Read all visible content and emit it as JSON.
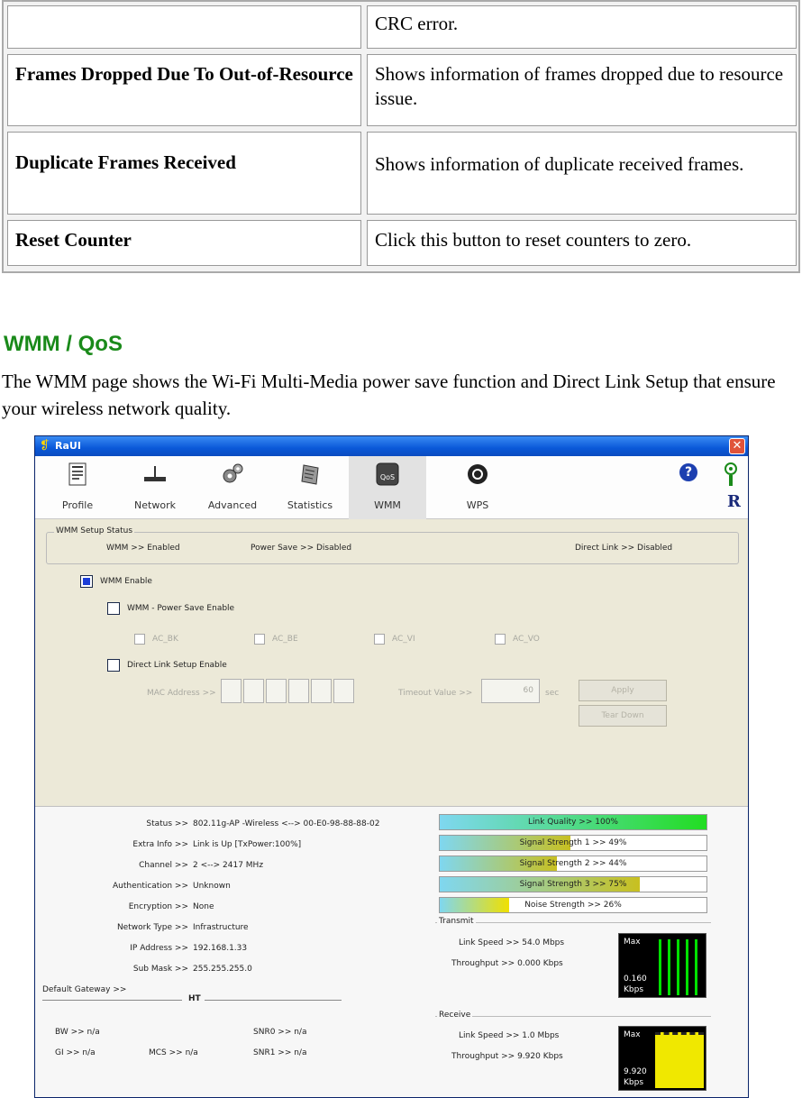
{
  "doc_table": {
    "rows": [
      {
        "key": "",
        "value": "CRC error."
      },
      {
        "key": "Frames Dropped Due To Out-of-Resource",
        "value": "Shows information of frames dropped due to resource issue."
      },
      {
        "key": "Duplicate Frames Received",
        "value": "Shows information of duplicate received frames."
      },
      {
        "key": "Reset Counter",
        "value": "Click this button to reset counters to zero."
      }
    ]
  },
  "section": {
    "title": "WMM / QoS",
    "intro": "The WMM page shows the Wi-Fi Multi-Media power save function and Direct Link Setup that ensure your wireless network quality."
  },
  "window": {
    "title": "RaUI",
    "toolbar": [
      "Profile",
      "Network",
      "Advanced",
      "Statistics",
      "WMM",
      "WPS"
    ],
    "active_tab": "WMM",
    "logo_text": "R",
    "status_group": {
      "legend": "WMM Setup Status",
      "wmm": "WMM >> Enabled",
      "power_save": "Power Save >> Disabled",
      "direct_link": "Direct Link >> Disabled"
    },
    "wmm_enable": {
      "label": "WMM Enable",
      "checked": true
    },
    "power_save_enable": {
      "label": "WMM - Power Save Enable",
      "checked": false
    },
    "ac": [
      "AC_BK",
      "AC_BE",
      "AC_VI",
      "AC_VO"
    ],
    "dls_enable": {
      "label": "Direct Link Setup Enable",
      "checked": false
    },
    "mac_label": "MAC Address >>",
    "timeout_label": "Timeout Value >>",
    "timeout_value": "60",
    "timeout_unit": "sec",
    "apply_label": "Apply",
    "teardown_label": "Tear Down",
    "info": {
      "status_key": "Status >>",
      "status_val": "802.11g-AP -Wireless <--> 00-E0-98-88-88-02",
      "extra_key": "Extra Info >>",
      "extra_val": "Link is Up [TxPower:100%]",
      "channel_key": "Channel >>",
      "channel_val": "2 <--> 2417 MHz",
      "auth_key": "Authentication >>",
      "auth_val": "Unknown",
      "enc_key": "Encryption >>",
      "enc_val": "None",
      "nettype_key": "Network Type >>",
      "nettype_val": "Infrastructure",
      "ip_key": "IP Address >>",
      "ip_val": "192.168.1.33",
      "mask_key": "Sub Mask >>",
      "mask_val": "255.255.255.0",
      "gw_key": "Default Gateway >>",
      "gw_val": "",
      "ht_label": "HT",
      "bw": "BW >> n/a",
      "gi": "GI >> n/a",
      "mcs": "MCS >> n/a",
      "snr0": "SNR0 >> n/a",
      "snr1": "SNR1 >> n/a"
    },
    "bars": [
      {
        "label": "Link Quality >> 100%",
        "level": 1.0,
        "color": "#22dd22"
      },
      {
        "label": "Signal Strength 1 >> 49%",
        "level": 0.49,
        "color": "#c8c020"
      },
      {
        "label": "Signal Strength 2 >> 44%",
        "level": 0.44,
        "color": "#c8c020"
      },
      {
        "label": "Signal Strength 3 >> 75%",
        "level": 0.75,
        "color": "#c8c020"
      },
      {
        "label": "Noise Strength >> 26%",
        "level": 0.26,
        "color": "#f0e000"
      }
    ],
    "transmit": {
      "label": "Transmit",
      "link_speed": "Link Speed >> 54.0 Mbps",
      "throughput": "Throughput >> 0.000 Kbps",
      "meter_max": "Max",
      "meter_value": "0.160",
      "meter_unit": "Kbps"
    },
    "receive": {
      "label": "Receive",
      "link_speed": "Link Speed >> 1.0 Mbps",
      "throughput": "Throughput >> 9.920 Kbps",
      "meter_max": "Max",
      "meter_value": "9.920",
      "meter_unit": "Kbps"
    },
    "colors": {
      "title_bar": "#0a58d8",
      "section_title": "#1a8a1a"
    }
  }
}
